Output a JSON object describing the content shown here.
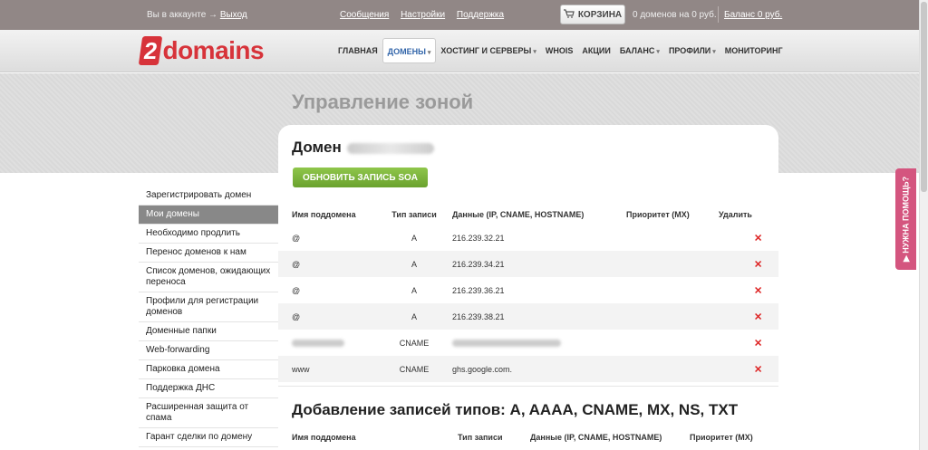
{
  "topbar": {
    "account_text": "Вы в аккаунте →",
    "logout": "Выход",
    "links": [
      "Сообщения",
      "Настройки",
      "Поддержка"
    ],
    "cart_label": "КОРЗИНА",
    "cart_info": "0 доменов на 0 руб.",
    "balance": "Баланс 0 руб."
  },
  "logo": {
    "digit": "2",
    "name": "domains"
  },
  "nav": [
    {
      "label": "ГЛАВНАЯ",
      "caret": ""
    },
    {
      "label": "ДОМЕНЫ",
      "caret": "▾"
    },
    {
      "label": "ХОСТИНГ И СЕРВЕРЫ",
      "caret": "▾"
    },
    {
      "label": "WHOIS",
      "caret": ""
    },
    {
      "label": "АКЦИИ",
      "caret": ""
    },
    {
      "label": "БАЛАНС",
      "caret": "▾"
    },
    {
      "label": "ПРОФИЛИ",
      "caret": "▾"
    },
    {
      "label": "МОНИТОРИНГ",
      "caret": ""
    }
  ],
  "page_title": "Управление зоной",
  "sidebar": [
    "Зарегистрировать домен",
    "Мои домены",
    "Необходимо продлить",
    "Перенос доменов к нам",
    "Список доменов, ожидающих переноса",
    "Профили для регистрации доменов",
    "Доменные папки",
    "Web-forwarding",
    "Парковка домена",
    "Поддержка ДНС",
    "Расширенная защита от спама",
    "Гарант сделки по домену"
  ],
  "domain_label": "Домен",
  "soa_button": "ОБНОВИТЬ ЗАПИСЬ SOA",
  "table": {
    "headers": [
      "Имя поддомена",
      "Тип записи",
      "Данные (IP, CNAME, HOSTNAME)",
      "Приоритет (MX)",
      "Удалить"
    ],
    "rows": [
      {
        "name": "@",
        "type": "A",
        "data": "216.239.32.21"
      },
      {
        "name": "@",
        "type": "A",
        "data": "216.239.34.21"
      },
      {
        "name": "@",
        "type": "A",
        "data": "216.239.36.21"
      },
      {
        "name": "@",
        "type": "A",
        "data": "216.239.38.21"
      },
      {
        "name": "",
        "type": "CNAME",
        "data": ""
      },
      {
        "name": "www",
        "type": "CNAME",
        "data": "ghs.google.com."
      }
    ],
    "delete_glyph": "✕"
  },
  "add_section": {
    "title": "Добавление записей типов: A, AAAA, CNAME, MX, NS, TXT",
    "headers": [
      "Имя поддомена",
      "Тип записи",
      "Данные (IP, CNAME, HOSTNAME)",
      "Приоритет (MX)"
    ]
  },
  "help_tab": "▶ НУЖНА ПОМОЩЬ?"
}
